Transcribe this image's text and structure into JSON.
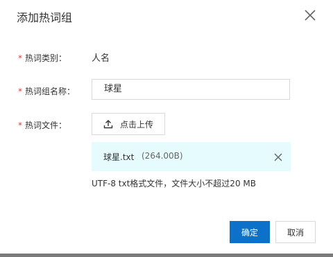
{
  "dialog": {
    "title": "添加热词组",
    "close_icon": "close-icon"
  },
  "form": {
    "required_mark": "*",
    "category": {
      "label": "热词类别：",
      "value": "人名"
    },
    "group_name": {
      "label": "热词组名称：",
      "value": "球星"
    },
    "file": {
      "label": "热词文件：",
      "upload_label": "点击上传",
      "upload_icon": "upload-icon",
      "file_name": "球星.txt",
      "file_size": "(264.00B)",
      "remove_icon": "close-icon",
      "hint": "UTF-8 txt格式文件，文件大小不超过20 MB"
    }
  },
  "footer": {
    "confirm_label": "确定",
    "cancel_label": "取消"
  },
  "colors": {
    "primary": "#0d70c9",
    "required": "#e4393c",
    "file_bg": "#e6fbfd"
  }
}
